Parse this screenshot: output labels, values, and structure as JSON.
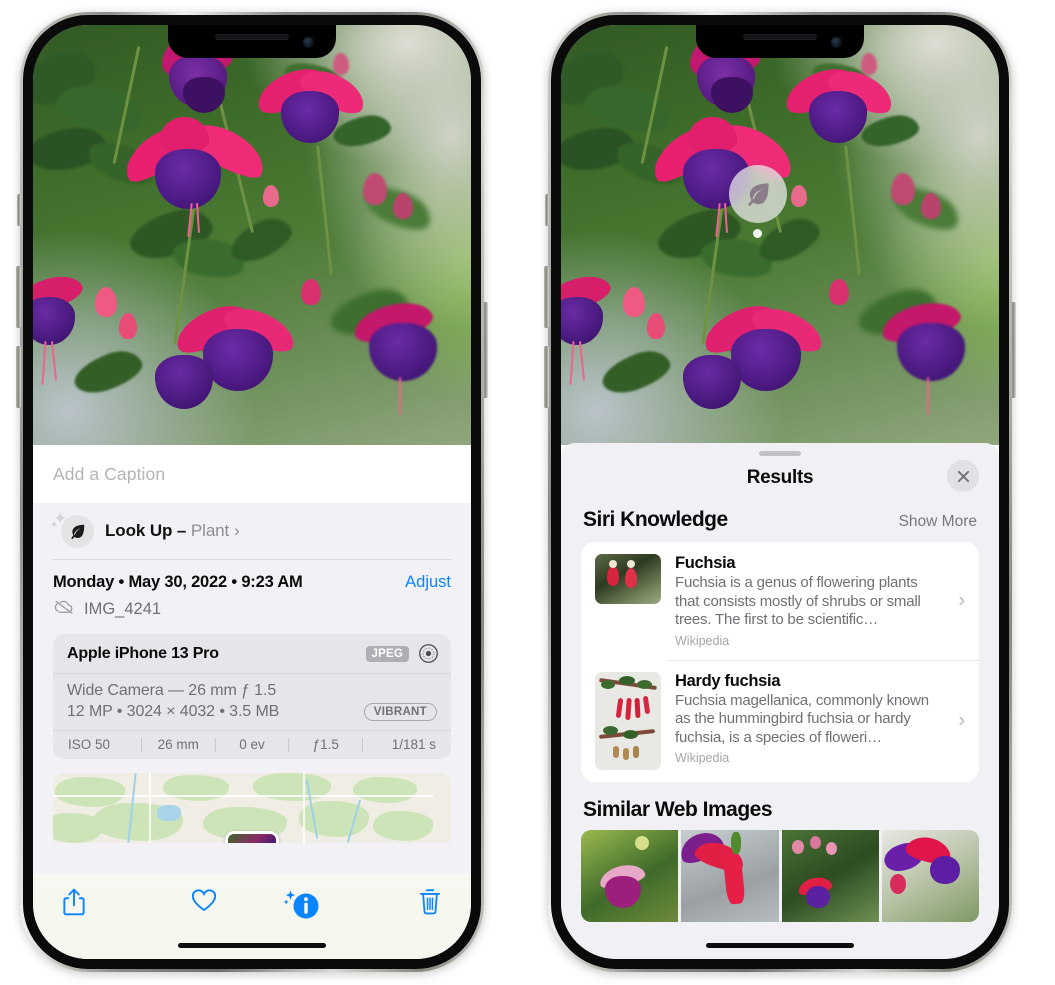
{
  "left_phone": {
    "caption_placeholder": "Add a Caption",
    "lookup": {
      "icon": "leaf-icon",
      "label": "Look Up",
      "dash": " – ",
      "subject": "Plant",
      "chevron": "›"
    },
    "meta": {
      "date": "Monday • May 30, 2022 • 9:23 AM",
      "adjust_label": "Adjust",
      "filename": "IMG_4241",
      "cloud_icon": "icloud-slash-icon"
    },
    "camera": {
      "model": "Apple iPhone 13 Pro",
      "format_chip": "JPEG",
      "aperture_icon": "aperture-icon",
      "lens_line": "Wide Camera — 26 mm ƒ 1.5",
      "specs_line": "12 MP • 3024 × 4032 • 3.5 MB",
      "style_chip": "VIBRANT",
      "exif": [
        "ISO 50",
        "26 mm",
        "0 ev",
        "ƒ1.5",
        "1/181 s"
      ]
    },
    "toolbar": [
      {
        "name": "share-button",
        "icon": "share-icon"
      },
      {
        "name": "favorite-button",
        "icon": "heart-icon"
      },
      {
        "name": "info-button",
        "icon": "info-sparkle-icon"
      },
      {
        "name": "delete-button",
        "icon": "trash-icon"
      }
    ]
  },
  "right_phone": {
    "photo_badge": {
      "icon": "leaf-icon",
      "name": "visual-lookup-leaf-badge"
    },
    "results": {
      "title": "Results",
      "close_icon": "close-icon",
      "sections": [
        {
          "title": "Siri Knowledge",
          "action": "Show More",
          "cards": [
            {
              "title": "Fuchsia",
              "description": "Fuchsia is a genus of flowering plants that consists mostly of shrubs or small trees. The first to be scientific…",
              "source": "Wikipedia",
              "chevron": "›"
            },
            {
              "title": "Hardy fuchsia",
              "description": "Fuchsia magellanica, commonly known as the hummingbird fuchsia or hardy fuchsia, is a species of floweri…",
              "source": "Wikipedia",
              "chevron": "›"
            }
          ]
        },
        {
          "title": "Similar Web Images",
          "thumbnails": [
            "web-image-1",
            "web-image-2",
            "web-image-3",
            "web-image-4"
          ]
        }
      ]
    }
  },
  "colors": {
    "accent_blue": "#0a84ff",
    "sheet_bg": "#f2f2f6",
    "card_bg": "#ffffff",
    "secondary_text": "#6f6f75",
    "chip_grey": "#aeaeb4"
  }
}
